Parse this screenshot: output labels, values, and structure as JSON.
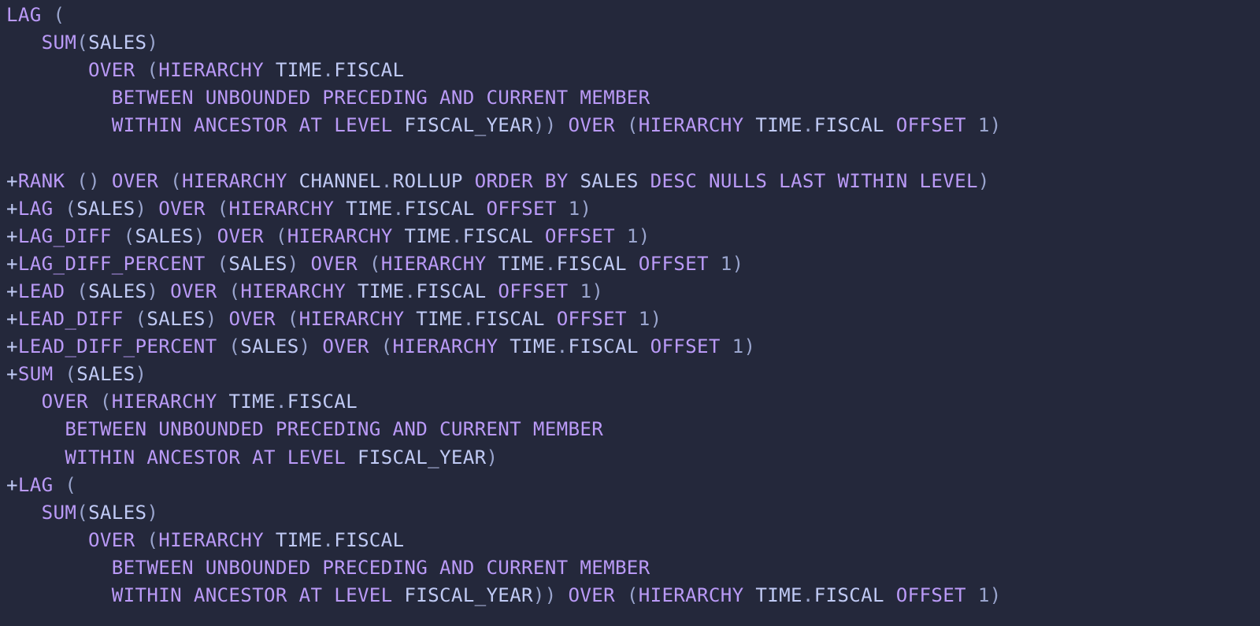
{
  "colors": {
    "bg": "#24283b",
    "keyword": "#ba9af7",
    "ident": "#c0caf5",
    "muted": "#9aa5ce"
  },
  "tokens": {
    "LAG": "LAG",
    "SUM": "SUM",
    "RANK": "RANK",
    "LAG_DIFF": "LAG_DIFF",
    "LAG_DIFF_PERCENT": "LAG_DIFF_PERCENT",
    "LEAD": "LEAD",
    "LEAD_DIFF": "LEAD_DIFF",
    "LEAD_DIFF_PERCENT": "LEAD_DIFF_PERCENT",
    "OVER": "OVER",
    "HIERARCHY": "HIERARCHY",
    "TIME": "TIME",
    "FISCAL": "FISCAL",
    "CHANNEL": "CHANNEL",
    "ROLLUP": "ROLLUP",
    "ORDER_BY": "ORDER BY",
    "DESC": "DESC",
    "NULLS": "NULLS",
    "LAST": "LAST",
    "WITHIN": "WITHIN",
    "LEVEL": "LEVEL",
    "BETWEEN": "BETWEEN",
    "UNBOUNDED": "UNBOUNDED",
    "PRECEDING": "PRECEDING",
    "AND": "AND",
    "CURRENT": "CURRENT",
    "MEMBER": "MEMBER",
    "ANCESTOR": "ANCESTOR",
    "AT": "AT",
    "OFFSET": "OFFSET",
    "SALES": "SALES",
    "FISCAL_YEAR": "FISCAL_YEAR",
    "ONE": "1",
    "DOT": ".",
    "LP": "(",
    "RP": ")",
    "PLUS": "+"
  }
}
